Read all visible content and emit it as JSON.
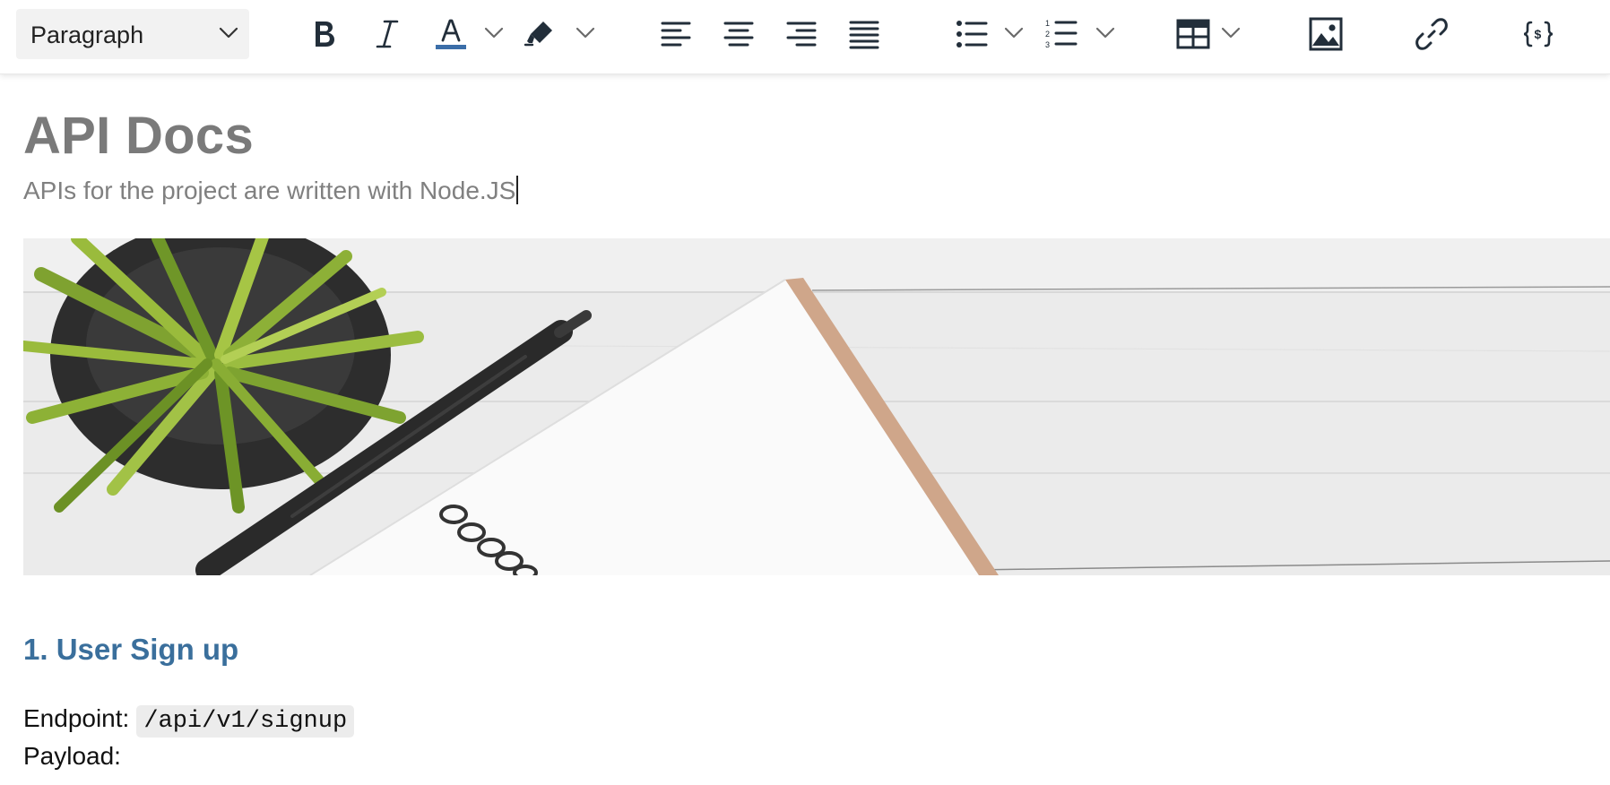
{
  "toolbar": {
    "block_format": "Paragraph",
    "buttons": [
      "bold",
      "italic",
      "font-color",
      "highlight",
      "align-left",
      "align-center",
      "align-right",
      "justify",
      "bulleted-list",
      "numbered-list",
      "table",
      "image",
      "link",
      "code-block"
    ],
    "font_color_swatch": "#3b6ea8",
    "icon_color": "#222e3a"
  },
  "document": {
    "title": "API Docs",
    "subtitle": "APIs for the project are written with Node.JS",
    "section_heading": "1. User Sign up",
    "endpoint_label": "Endpoint:",
    "endpoint_value": "/api/v1/signup",
    "payload_label": "Payload:",
    "heading_color": "#3a6f9c"
  },
  "banner": {
    "description_icon": "image"
  }
}
